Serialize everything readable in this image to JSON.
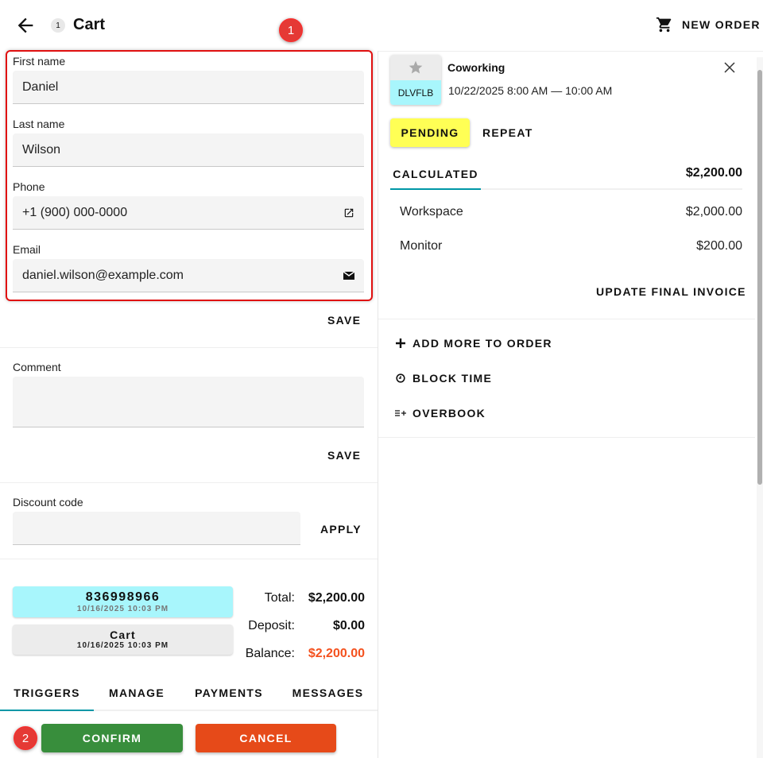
{
  "header": {
    "title": "Cart",
    "count": "1",
    "new_order": "NEW ORDER"
  },
  "annotations": [
    "1",
    "2"
  ],
  "form": {
    "first_name": {
      "label": "First name",
      "value": "Daniel"
    },
    "last_name": {
      "label": "Last name",
      "value": "Wilson"
    },
    "phone": {
      "label": "Phone",
      "value": "+1 (900) 000-0000"
    },
    "email": {
      "label": "Email",
      "value": "daniel.wilson@example.com"
    },
    "save": "SAVE",
    "comment": {
      "label": "Comment",
      "value": ""
    },
    "save2": "SAVE",
    "discount": {
      "label": "Discount code",
      "value": "",
      "apply": "APPLY"
    }
  },
  "order": {
    "number": "836998966",
    "number_date": "10/16/2025 10:03 PM",
    "status": "Cart",
    "status_date": "10/16/2025 10:03 PM"
  },
  "totals": {
    "total_label": "Total:",
    "total": "$2,200.00",
    "deposit_label": "Deposit:",
    "deposit": "$0.00",
    "balance_label": "Balance:",
    "balance": "$2,200.00"
  },
  "tabs": [
    "TRIGGERS",
    "MANAGE",
    "PAYMENTS",
    "MESSAGES"
  ],
  "actions": {
    "confirm": "CONFIRM",
    "cancel": "CANCEL"
  },
  "booking": {
    "code": "DLVFLB",
    "name": "Coworking",
    "time": "10/22/2025 8:00 AM — 10:00 AM",
    "status": "PENDING",
    "repeat": "REPEAT",
    "calc_tab": "CALCULATED",
    "calc_total": "$2,200.00",
    "items": [
      {
        "name": "Workspace",
        "price": "$2,000.00"
      },
      {
        "name": "Monitor",
        "price": "$200.00"
      }
    ],
    "update_invoice": "UPDATE FINAL INVOICE"
  },
  "menu": {
    "add_more": "ADD MORE TO ORDER",
    "block_time": "BLOCK TIME",
    "overbook": "OVERBOOK"
  },
  "colors": {
    "accent": "#0097a7",
    "pending": "#ffff55",
    "confirm": "#388e3c",
    "cancel": "#e64a19",
    "balance": "#f4511e",
    "code_bg": "#a8f6fc"
  }
}
